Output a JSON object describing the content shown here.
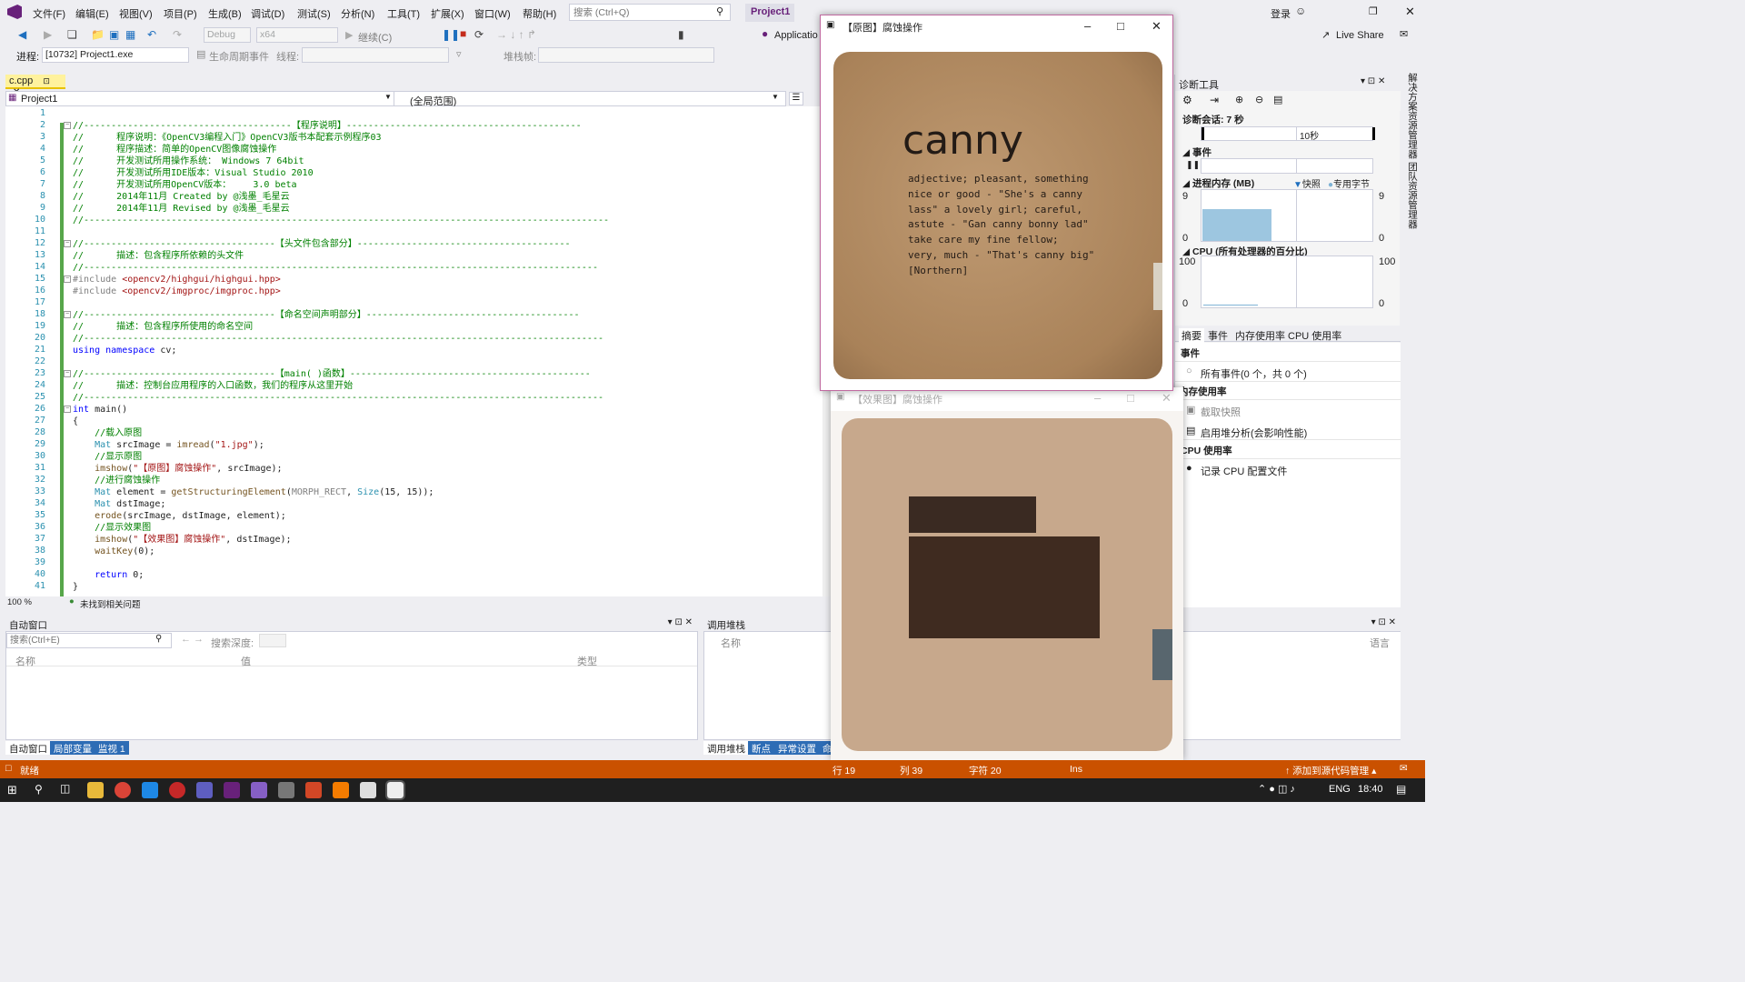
{
  "menubar": {
    "items": [
      "文件(F)",
      "编辑(E)",
      "视图(V)",
      "项目(P)",
      "生成(B)",
      "调试(D)",
      "测试(S)",
      "分析(N)",
      "工具(T)",
      "扩展(X)",
      "窗口(W)",
      "帮助(H)"
    ],
    "search_placeholder": "搜索 (Ctrl+Q)",
    "project_title": "Project1",
    "login": "登录",
    "live_share": "Live Share"
  },
  "toolbar": {
    "config": "Debug",
    "platform": "x64",
    "continue": "继续(C)",
    "application_label": "Applicatio",
    "process_label": "进程:",
    "process_value": "[10732] Project1.exe",
    "lifecycle": "生命周期事件",
    "thread_label": "线程:",
    "stackframe_label": "堆栈帧:"
  },
  "editor": {
    "tab_name": "c.cpp",
    "nav_left": "Project1",
    "nav_right": "(全局范围)",
    "zoom": "100 %",
    "issues": "未找到相关问题",
    "lines": [
      "",
      "//--------------------------------------【程序说明】-------------------------------------------",
      "//      程序说明：《OpenCV3编程入门》OpenCV3版书本配套示例程序03",
      "//      程序描述：简单的OpenCV图像腐蚀操作",
      "//      开发测试所用操作系统： Windows 7 64bit",
      "//      开发测试所用IDE版本：Visual Studio 2010",
      "//      开发测试所用OpenCV版本：    3.0 beta",
      "//      2014年11月 Created by @浅墨_毛星云",
      "//      2014年11月 Revised by @浅墨_毛星云",
      "//------------------------------------------------------------------------------------------------",
      "",
      "//-----------------------------------【头文件包含部分】---------------------------------------",
      "//      描述：包含程序所依赖的头文件",
      "//----------------------------------------------------------------------------------------------",
      "#include <opencv2/highgui/highgui.hpp>",
      "#include <opencv2/imgproc/imgproc.hpp>",
      "",
      "//-----------------------------------【命名空间声明部分】---------------------------------------",
      "//      描述：包含程序所使用的命名空间",
      "//-----------------------------------------------------------------------------------------------",
      "using namespace cv;",
      "",
      "//-----------------------------------【main( )函数】--------------------------------------------",
      "//      描述：控制台应用程序的入口函数，我们的程序从这里开始",
      "//-----------------------------------------------------------------------------------------------",
      "int main()",
      "{",
      "    //载入原图",
      "    Mat srcImage = imread(\"1.jpg\");",
      "    //显示原图",
      "    imshow(\"【原图】腐蚀操作\", srcImage);",
      "    //进行腐蚀操作",
      "    Mat element = getStructuringElement(MORPH_RECT, Size(15, 15));",
      "    Mat dstImage;",
      "    erode(srcImage, dstImage, element);",
      "    //显示效果图",
      "    imshow(\"【效果图】腐蚀操作\", dstImage);",
      "    waitKey(0);",
      "",
      "    return 0;",
      "}"
    ]
  },
  "auto_window": {
    "title": "自动窗口",
    "search_placeholder": "搜索(Ctrl+E)",
    "depth_label": "搜索深度:",
    "columns": [
      "名称",
      "值",
      "类型"
    ],
    "tabs": [
      "自动窗口",
      "局部变量",
      "监视 1"
    ]
  },
  "callstack": {
    "title": "调用堆栈",
    "columns": [
      "名称",
      "语言"
    ],
    "tabs": [
      "调用堆栈",
      "断点",
      "异常设置",
      "命"
    ]
  },
  "original_window": {
    "title": "【原图】腐蚀操作",
    "word": "canny",
    "definition": [
      "adjective; pleasant, something",
      "nice or good - \"She's a canny",
      "lass\" a lovely girl; careful,",
      "astute - \"Gan canny bonny lad\"",
      "take care my fine fellow;",
      "very, much - \"That's canny big\"",
      "[Northern]"
    ]
  },
  "result_window": {
    "title": "【效果图】腐蚀操作"
  },
  "diag": {
    "title": "诊断工具",
    "session": "诊断会话: 7 秒",
    "timeline_label": "10秒",
    "events_label": "事件",
    "memory_label": "进程内存 (MB)",
    "snapshot_legend": "快照",
    "private_legend": "专用字节",
    "mem_max": "9",
    "mem_min": "0",
    "cpu_label": "CPU (所有处理器的百分比)",
    "cpu_max": "100",
    "cpu_min": "0",
    "tabs": [
      "摘要",
      "事件",
      "内存使用率",
      "CPU 使用率"
    ],
    "events_section": "事件",
    "all_events": "所有事件(0 个，共 0 个)",
    "mem_section": "内存使用率",
    "take_snapshot": "截取快照",
    "heap_profiling": "启用堆分析(会影响性能)",
    "cpu_section": "CPU 使用率",
    "record_cpu": "记录 CPU 配置文件",
    "memory_fill": 0.62
  },
  "right_strip": [
    "解决方案资源管理器",
    "团队资源管理器"
  ],
  "status": {
    "ready": "就绪",
    "line": "行 19",
    "col": "列 39",
    "char": "字符 20",
    "ins": "Ins",
    "source_control": "添加到源代码管理"
  },
  "taskbar": {
    "lang": "ENG",
    "time": "18:40"
  },
  "colors": {
    "accent": "#68217a",
    "status": "#ca5100",
    "taskbar": "#1f1f1f"
  }
}
